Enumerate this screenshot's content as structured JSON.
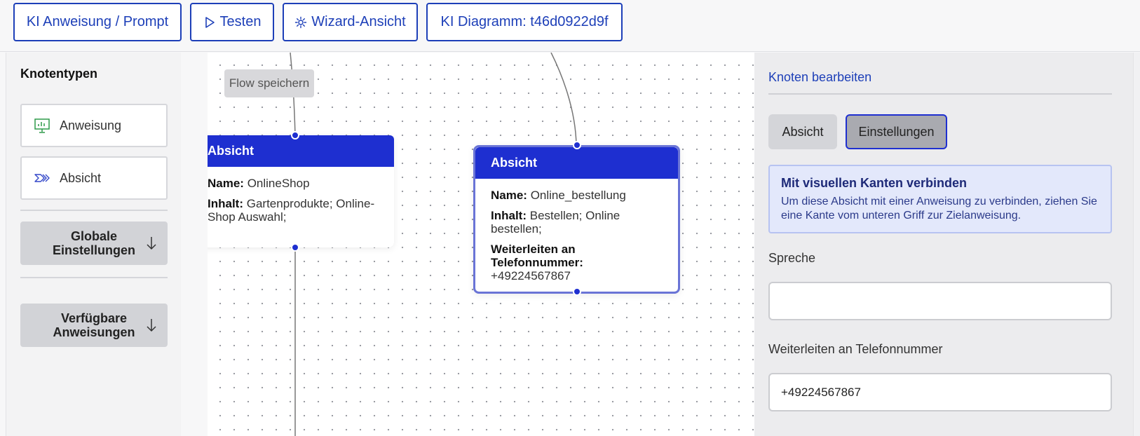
{
  "toolbar": {
    "prompt_tab": "KI Anweisung / Prompt",
    "test_tab": "Testen",
    "wizard_tab": "Wizard-Ansicht",
    "diagram_tab": "KI Diagramm: t46d0922d9f",
    "icons": [
      "play-icon",
      "gear-icon"
    ]
  },
  "sidebar": {
    "title": "Knotentypen",
    "node_types": [
      {
        "label": "Anweisung",
        "icon": "presentation-icon"
      },
      {
        "label": "Absicht",
        "icon": "intent-arrows-icon"
      }
    ],
    "accordions": [
      {
        "label": "Globale Einstellungen",
        "icon": "arrow-down-icon"
      },
      {
        "label": "Verfügbare Anweisungen",
        "icon": "arrow-down-icon"
      }
    ]
  },
  "canvas": {
    "save_button": "Flow speichern",
    "nodes": [
      {
        "header": "Absicht",
        "name_label": "Name:",
        "name_value": "OnlineShop",
        "content_label": "Inhalt:",
        "content_value": "Gartenprodukte; Online-Shop Auswahl;"
      },
      {
        "header": "Absicht",
        "name_label": "Name:",
        "name_value": "Online_bestellung",
        "content_label": "Inhalt:",
        "content_value": "Bestellen; Online bestellen;",
        "forward_label": "Weiterleiten an Telefonnummer:",
        "forward_value": "+49224567867"
      }
    ]
  },
  "panel": {
    "title": "Knoten bearbeiten",
    "tabs": {
      "intent": "Absicht",
      "settings": "Einstellungen"
    },
    "info_title": "Mit visuellen Kanten verbinden",
    "info_text": "Um diese Absicht mit einer Anweisung zu verbinden, ziehen Sie eine Kante vom unteren Griff zur Zielanweisung.",
    "speak_label": "Spreche",
    "speak_value": "",
    "forward_label": "Weiterleiten an Telefonnummer",
    "forward_value": "+49224567867"
  },
  "colors": {
    "accent": "#1d3fb8",
    "node_header": "#1e2fd0",
    "info_bg": "#e3e8fb"
  }
}
